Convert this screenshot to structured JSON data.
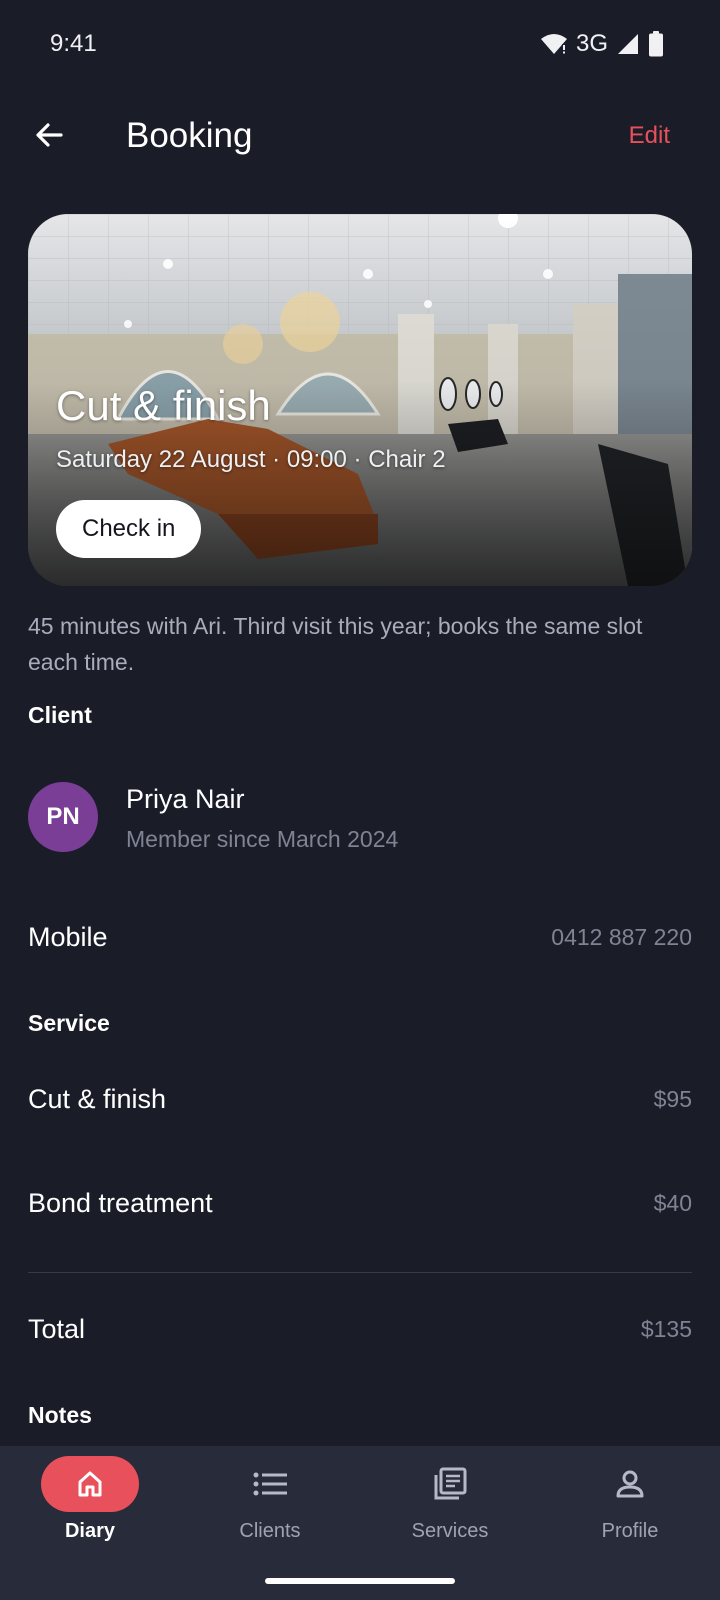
{
  "status_bar": {
    "time": "9:41",
    "network": "3G"
  },
  "app_bar": {
    "title": "Booking",
    "edit_label": "Edit"
  },
  "hero": {
    "title": "Cut & finish",
    "subtitle": "Saturday 22 August · 09:00 · Chair 2",
    "check_in_label": "Check in"
  },
  "description": "45 minutes with Ari. Third visit this year; books the same slot each time.",
  "client": {
    "section_label": "Client",
    "initials": "PN",
    "name": "Priya Nair",
    "member_since": "Member since March 2024",
    "avatar_color": "#7a3e96"
  },
  "mobile": {
    "label": "Mobile",
    "value": "0412 887 220"
  },
  "service": {
    "section_label": "Service",
    "items": [
      {
        "label": "Cut & finish",
        "price": "$95"
      },
      {
        "label": "Bond treatment",
        "price": "$40"
      }
    ],
    "total_label": "Total",
    "total_value": "$135"
  },
  "notes": {
    "section_label": "Notes"
  },
  "bottom_nav": {
    "items": [
      {
        "label": "Diary",
        "icon": "home-icon",
        "active": true
      },
      {
        "label": "Clients",
        "icon": "list-icon",
        "active": false
      },
      {
        "label": "Services",
        "icon": "services-icon",
        "active": false
      },
      {
        "label": "Profile",
        "icon": "profile-icon",
        "active": false
      }
    ]
  },
  "colors": {
    "background": "#1a1c28",
    "accent": "#e8515b",
    "nav_background": "#282b39"
  }
}
